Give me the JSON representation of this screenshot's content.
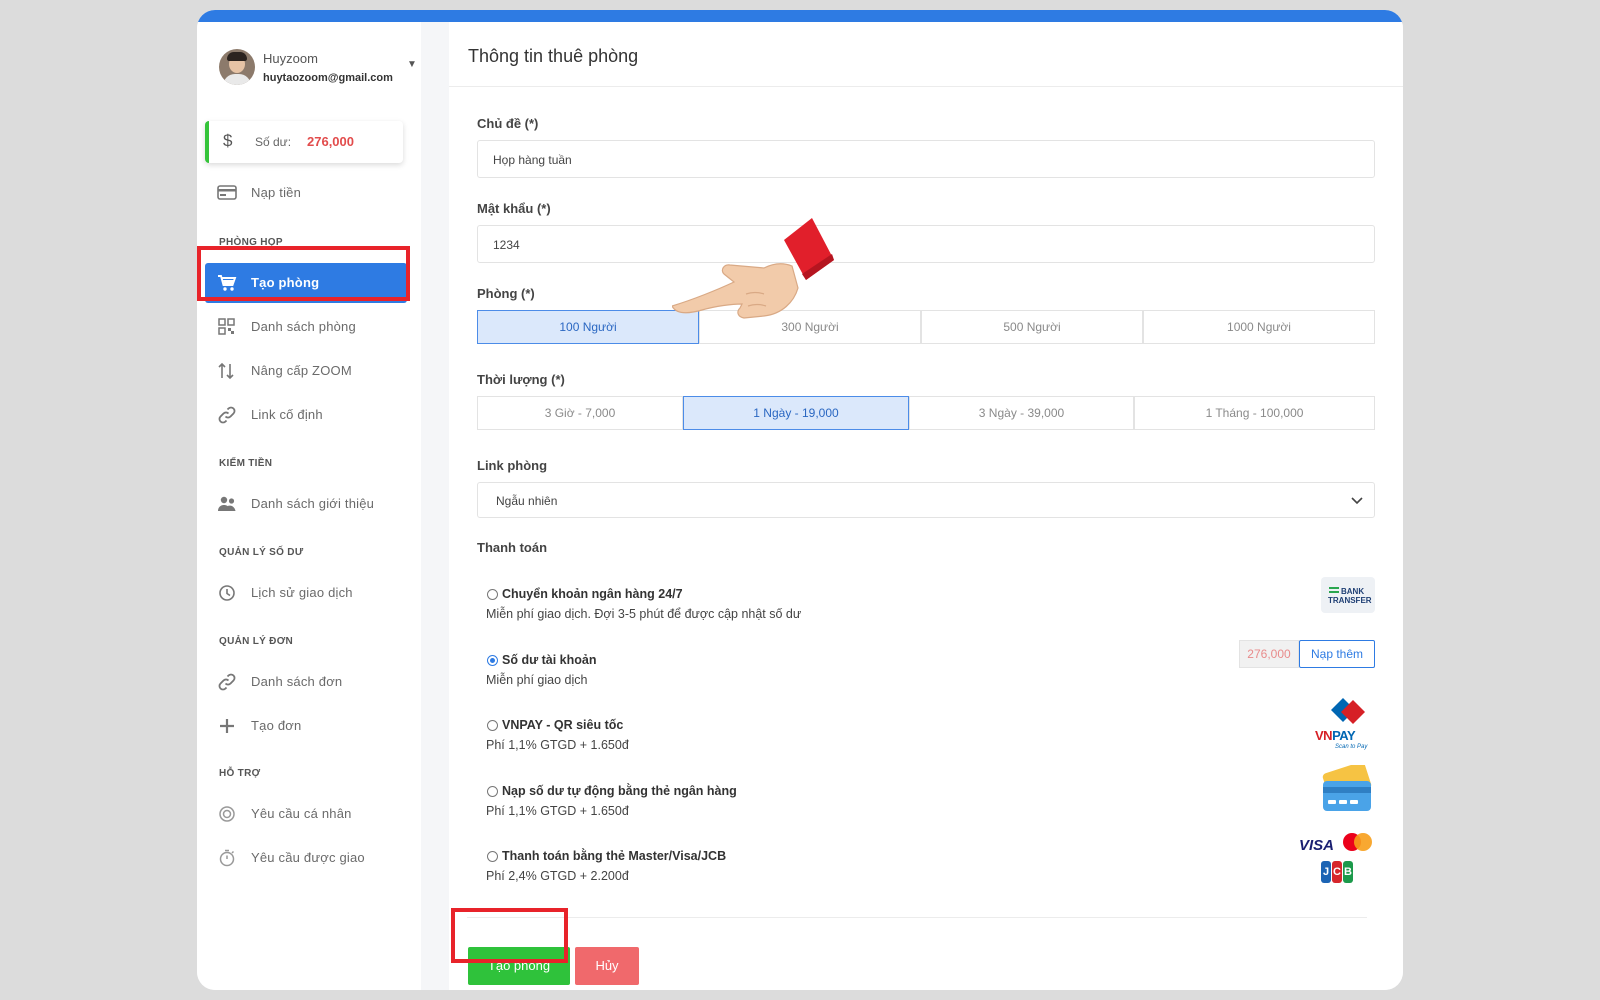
{
  "user": {
    "name": "Huyzoom",
    "email": "huytaozoom@gmail.com"
  },
  "balance": {
    "label": "Số dư:",
    "amount": "276,000"
  },
  "sidebar": {
    "topup": "Nạp tiền",
    "sections": {
      "rooms": "PHÒNG HỌP",
      "earn": "KIẾM TIỀN",
      "balance": "QUẢN LÝ SỐ DƯ",
      "orders": "QUẢN LÝ ĐƠN",
      "support": "HỖ TRỢ"
    },
    "items": {
      "create_room": "Tạo phòng",
      "room_list": "Danh sách phòng",
      "upgrade": "Nâng cấp ZOOM",
      "fixed_link": "Link cố định",
      "referrals": "Danh sách giới thiệu",
      "history": "Lịch sử giao dịch",
      "order_list": "Danh sách đơn",
      "create_order": "Tạo đơn",
      "personal_request": "Yêu cầu cá nhân",
      "assigned_request": "Yêu cầu được giao"
    }
  },
  "form": {
    "title": "Thông tin thuê phòng",
    "topic_label": "Chủ đề (*)",
    "topic_value": "Họp hàng tuần",
    "password_label": "Mật khẩu (*)",
    "password_value": "1234",
    "room_label": "Phòng (*)",
    "rooms": [
      "100 Người",
      "300 Người",
      "500 Người",
      "1000 Người"
    ],
    "selected_room": 0,
    "duration_label": "Thời lượng (*)",
    "durations": [
      "3 Giờ - 7,000",
      "1 Ngày - 19,000",
      "3 Ngày - 39,000",
      "1 Tháng - 100,000"
    ],
    "selected_duration": 1,
    "link_label": "Link phòng",
    "link_value": "Ngẫu nhiên",
    "payment_label": "Thanh toán",
    "payments": [
      {
        "title": "Chuyển khoản ngân hàng 24/7",
        "desc": "Miễn phí giao dịch. Đợi 3-5 phút để được cập nhật số dư",
        "selected": false
      },
      {
        "title": "Số dư tài khoản",
        "desc": "Miễn phí giao dịch",
        "selected": true
      },
      {
        "title": "VNPAY - QR siêu tốc",
        "desc": "Phí 1,1% GTGD + 1.650đ",
        "selected": false
      },
      {
        "title": "Nạp số dư tự động bằng thẻ ngân hàng",
        "desc": "Phí 1,1% GTGD + 1.650đ",
        "selected": false
      },
      {
        "title": "Thanh toán bằng thẻ Master/Visa/JCB",
        "desc": "Phí 2,4% GTGD + 2.200đ",
        "selected": false
      }
    ],
    "account_balance": "276,000",
    "topup_more": "Nạp thêm",
    "submit": "Tạo phòng",
    "cancel": "Hủy"
  },
  "logos": {
    "bank_line1": "BANK",
    "bank_line2": "TRANSFER",
    "vnpay_red": "VN",
    "vnpay_blue": "PAY",
    "vnpay_sub": "Scan to Pay",
    "visa": "VISA",
    "jcb": [
      "J",
      "C",
      "B"
    ]
  },
  "colors": {
    "accent": "#2e7be3",
    "success": "#2fc23b",
    "danger": "#f0696c",
    "highlight": "#e8232a",
    "balance_amount": "#e24c4c"
  }
}
